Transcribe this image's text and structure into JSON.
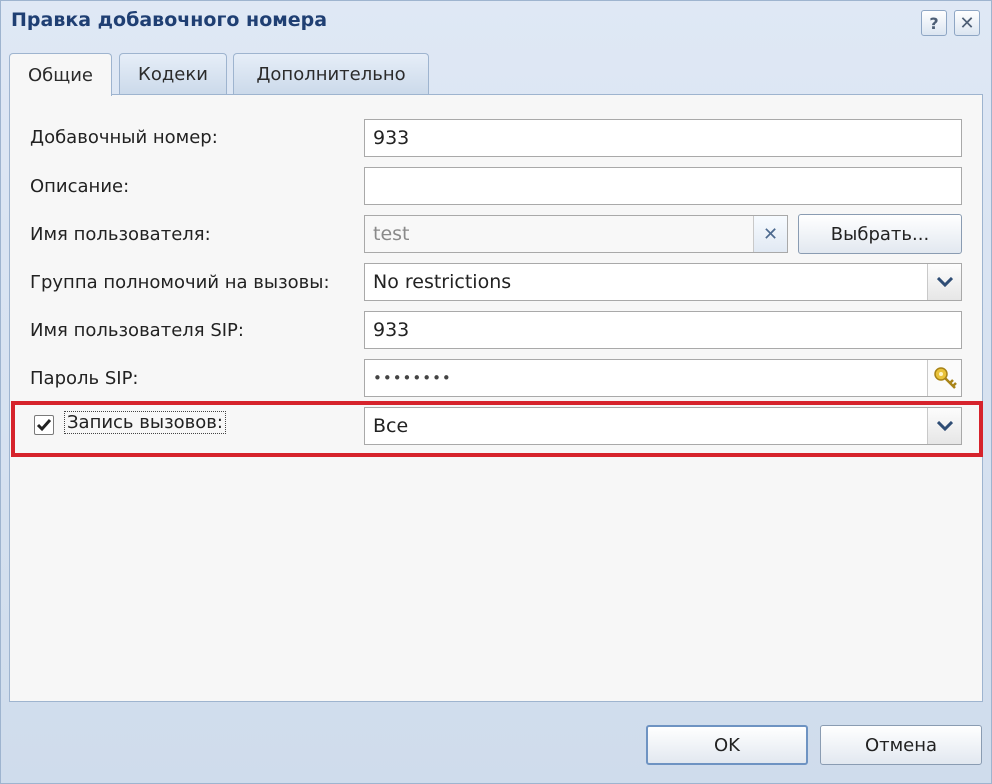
{
  "window": {
    "title": "Правка добавочного номера",
    "help_icon": "?",
    "close_icon": "✕"
  },
  "tabs": [
    {
      "label": "Общие",
      "active": true
    },
    {
      "label": "Кодеки",
      "active": false
    },
    {
      "label": "Дополнительно",
      "active": false
    }
  ],
  "form": {
    "extension": {
      "label": "Добавочный номер:",
      "value": "933"
    },
    "description": {
      "label": "Описание:",
      "value": ""
    },
    "username": {
      "label": "Имя пользователя:",
      "value": "test",
      "clear_icon": "✕",
      "choose_button": "Выбрать..."
    },
    "call_permissions": {
      "label": "Группа полномочий на вызовы:",
      "value": "No restrictions"
    },
    "sip_username": {
      "label": "Имя пользователя SIP:",
      "value": "933"
    },
    "sip_password": {
      "label": "Пароль SIP:",
      "value": "••••••••"
    },
    "call_recording": {
      "label": "Запись вызовов:",
      "checked": true,
      "value": "Все"
    }
  },
  "footer": {
    "ok_label": "OK",
    "cancel_label": "Отмена"
  },
  "colors": {
    "title": "#1f3f73",
    "highlight": "#d6232c"
  }
}
